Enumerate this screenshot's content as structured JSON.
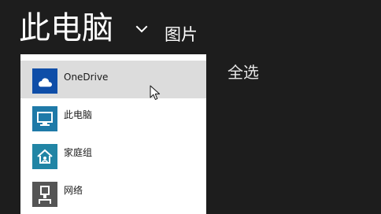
{
  "header": {
    "title": "此电脑",
    "subtitle": "图片"
  },
  "actions": {
    "select_all": "全选"
  },
  "menu": {
    "items": [
      {
        "label": "OneDrive",
        "icon": "onedrive-icon",
        "color": "#0f4ea8"
      },
      {
        "label": "此电脑",
        "icon": "this-pc-icon",
        "color": "#1f7aa8"
      },
      {
        "label": "家庭组",
        "icon": "homegroup-icon",
        "color": "#2185a5"
      },
      {
        "label": "网络",
        "icon": "network-icon",
        "color": "#555555"
      }
    ]
  },
  "colors": {
    "background": "#1d1d1d",
    "menu_background": "#ffffff",
    "menu_highlight": "#dcdcdc",
    "text_light": "#ffffff"
  }
}
